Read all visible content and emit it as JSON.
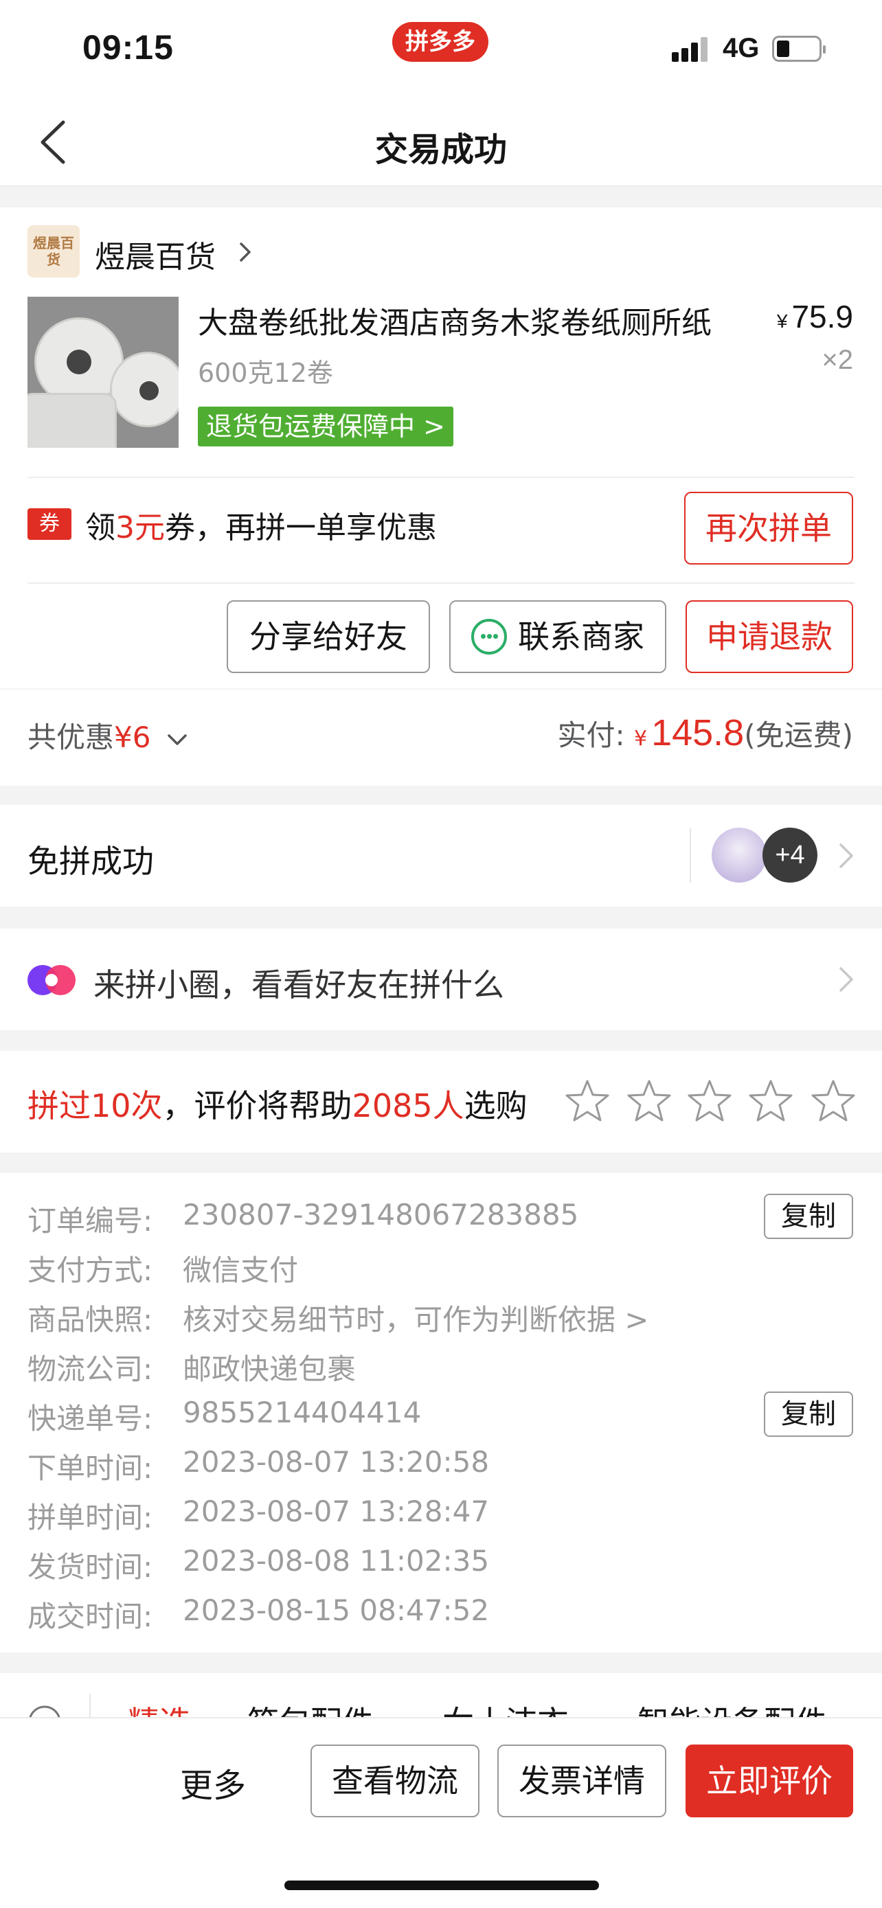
{
  "status_bar": {
    "time": "09:15",
    "app_badge": "拼多多",
    "network": "4G"
  },
  "nav": {
    "title": "交易成功"
  },
  "store": {
    "name": "煜晨百货",
    "logo_text": "煜晨百货"
  },
  "product": {
    "title": "大盘卷纸批发酒店商务木浆卷纸厕所纸",
    "spec": "600克12卷",
    "guarantee_badge": "退货包运费保障中 >",
    "currency": "¥",
    "price": "75.9",
    "quantity": "×2"
  },
  "coupon": {
    "tag": "券",
    "text_prefix": "领",
    "amount": "3元",
    "text_suffix": "券，再拼一单享优惠",
    "reorder_button": "再次拼单"
  },
  "actions": {
    "share": "分享给好友",
    "contact": "联系商家",
    "refund": "申请退款"
  },
  "totals": {
    "discount_label": "共优惠",
    "discount_amount": "¥6",
    "paid_label": "实付:",
    "currency": "¥",
    "paid_amount": "145.8",
    "shipping_note": "(免运费)"
  },
  "group": {
    "title": "免拼成功",
    "more_count": "+4"
  },
  "circle": {
    "text": "来拼小圈，看看好友在拼什么"
  },
  "review": {
    "prefix": "拼过10次",
    "middle": "，评价将帮助",
    "count": "2085人",
    "suffix": "选购",
    "stars": 5,
    "filled_stars": 0
  },
  "order_info": {
    "rows": [
      {
        "label": "订单编号:",
        "value": "230807-329148067283885",
        "copy": "复制"
      },
      {
        "label": "支付方式:",
        "value": "微信支付"
      },
      {
        "label": "商品快照:",
        "value": "核对交易细节时，可作为判断依据 >"
      },
      {
        "label": "物流公司:",
        "value": "邮政快递包裹"
      },
      {
        "label": "快递单号:",
        "value": "9855214404414",
        "copy": "复制"
      },
      {
        "label": "下单时间:",
        "value": "2023-08-07 13:20:58"
      },
      {
        "label": "拼单时间:",
        "value": "2023-08-07 13:28:47"
      },
      {
        "label": "发货时间:",
        "value": "2023-08-08 11:02:35"
      },
      {
        "label": "成交时间:",
        "value": "2023-08-15 08:47:52"
      }
    ]
  },
  "recommend_tabs": [
    "精选",
    "箱包配件",
    "女士洁衣",
    "智能设备配件"
  ],
  "bottom_bar": {
    "more": "更多",
    "logistics": "查看物流",
    "invoice": "发票详情",
    "review": "立即评价"
  },
  "colors": {
    "accent": "#e02e24",
    "guarantee_green": "#4fae32",
    "wechat_green": "#2aae67"
  }
}
